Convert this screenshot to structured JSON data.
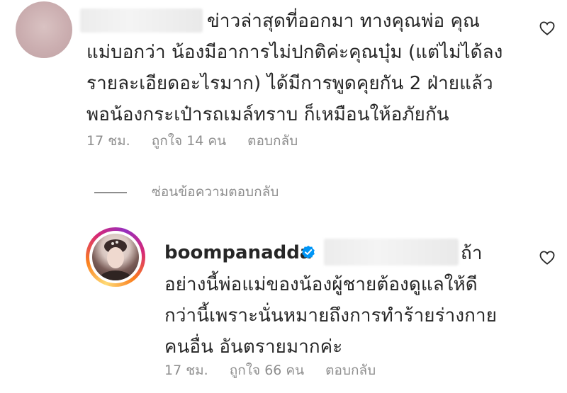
{
  "comment1": {
    "lines": [
      "ข่าวล่าสุดที่ออกมา ทางคุณพ่อ คุณ",
      "แม่บอกว่า น้องมีอาการไม่ปกติค่ะคุณบุ๋ม (แต่ไม่ได้ลง",
      "รายละเอียดอะไรมาก) ได้มีการพูดคุยกัน 2 ฝ่ายแล้ว",
      "พอน้องกระเป๋ารถเมล์ทราบ ก็เหมือนให้อภัยกัน"
    ],
    "time": "17 ชม.",
    "likes": "ถูกใจ 14 คน",
    "reply": "ตอบกลับ"
  },
  "hide_replies": "ซ่อนข้อความตอบกลับ",
  "comment2": {
    "username": "boompanadda",
    "line1_tail": "ถ้า",
    "lines": [
      "อย่างนี้พ่อแม่ของน้องผู้ชายต้องดูแลให้ดี",
      "กว่านี้เพราะนั่นหมายถึงการทำร้ายร่างกาย",
      "คนอื่น อันตรายมากค่ะ"
    ],
    "time": "17 ชม.",
    "likes": "ถูกใจ 66 คน",
    "reply": "ตอบกลับ"
  },
  "colors": {
    "text": "#262626",
    "meta": "#8e8e8e",
    "verified": "#0095f6"
  },
  "icons": [
    "heart-outline-icon",
    "verified-badge-icon"
  ]
}
